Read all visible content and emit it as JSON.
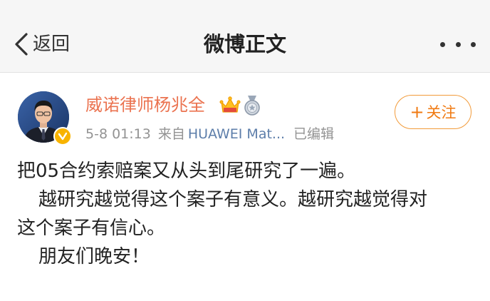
{
  "nav": {
    "back_label": "返回",
    "title": "微博正文"
  },
  "post": {
    "author": "威诺律师杨兆全",
    "date": "5-8 01:13",
    "source_prefix": "来自",
    "device": "HUAWEI Mat...",
    "edited": "已编辑",
    "follow_label": "关注",
    "lines": [
      "把05合约索赔案又从头到尾研究了一遍。",
      "越研究越觉得这个案子有意义。越研究越觉得对",
      "这个案子有信心。",
      "朋友们晚安！"
    ]
  },
  "colors": {
    "author_name": "#eb7350",
    "follow_accent": "#f07a12",
    "device_link": "#5d7eaa",
    "meta_gray": "#939393",
    "verified_badge": "#f8b300"
  },
  "icons": [
    "back-chevron-icon",
    "more-icon",
    "crown-icon",
    "medal-icon",
    "verified-v-icon"
  ]
}
